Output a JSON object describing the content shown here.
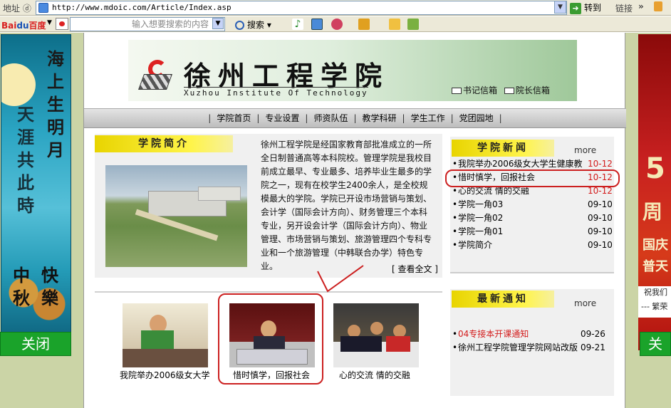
{
  "browser": {
    "address_label": "地址 ⓓ",
    "url": "http://www.mdoic.com/Article/Index.asp",
    "go_label": "转到",
    "links_label": "链接",
    "more_chevron": "»"
  },
  "baidu_toolbar": {
    "brand_a": "Bai",
    "brand_b": "du",
    "brand_c": "百度",
    "search_placeholder": "输入想要搜索的内容",
    "search_label": "搜索"
  },
  "left_ad": {
    "line1": "海上生明月",
    "line2": "天涯共此時",
    "line3": "中秋",
    "line4": "快樂",
    "close_label": "关闭"
  },
  "right_ad": {
    "big": "5",
    "mid": "周",
    "t1": "国庆",
    "t2": "普天",
    "t3": "祝我们",
    "t4": "--- 繁荣",
    "close_label": "关"
  },
  "site": {
    "chinese_name": "徐州工程学院",
    "english_name": "Xuzhou Institute Of Technology",
    "mailbox_secretary": "书记信箱",
    "mailbox_president": "院长信箱"
  },
  "nav": [
    "学院首页",
    "专业设置",
    "师资队伍",
    "教学科研",
    "学生工作",
    "党团园地"
  ],
  "intro": {
    "title": "学院简介",
    "text": "徐州工程学院是经国家教育部批准成立的一所全日制普通高等本科院校。管理学院是我校目前成立最早、专业最多、培养毕业生最多的学院之一，现有在校学生2400余人，是全校规模最大的学院。学院已开设市场营销与策划、会计学（国际会计方向）、财务管理三个本科专业，另开设会计学（国际会计方向）、物业管理、市场营销与策划、旅游管理四个专科专业和一个旅游管理（中韩联合办学）特色专业。",
    "more_label": "[ 查看全文 ]"
  },
  "college_news": {
    "title": "学院新闻",
    "more_label": "more",
    "items": [
      {
        "title": "我院举办2006级女大学生健康教",
        "date": "10-12",
        "red_date": true
      },
      {
        "title": "惜时慎学，回报社会",
        "date": "10-12",
        "red_date": true
      },
      {
        "title": "心的交流 情的交融",
        "date": "10-12",
        "red_date": true
      },
      {
        "title": "学院一角03",
        "date": "09-10",
        "red_date": false
      },
      {
        "title": "学院一角02",
        "date": "09-10",
        "red_date": false
      },
      {
        "title": "学院一角01",
        "date": "09-10",
        "red_date": false
      },
      {
        "title": "学院简介",
        "date": "09-10",
        "red_date": false
      }
    ]
  },
  "latest_notices": {
    "title": "最新通知",
    "more_label": "more",
    "items": [
      {
        "title": "04专接本开课通知",
        "date": "09-26",
        "red_title": true
      },
      {
        "title": "徐州工程学院管理学院网站改版",
        "date": "09-21",
        "red_title": false
      }
    ]
  },
  "photos": [
    {
      "caption": "我院举办2006级女大学"
    },
    {
      "caption": "惜时慎学，回报社会"
    },
    {
      "caption": "心的交流 情的交融"
    }
  ],
  "colors": {
    "accent_red": "#cc2020",
    "date_red": "#d31b1b",
    "yellow_tag": "#fff44a",
    "close_green": "#1aa32a"
  }
}
